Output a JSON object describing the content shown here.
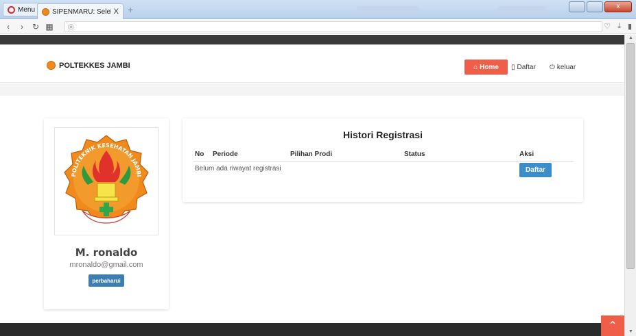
{
  "browser": {
    "menu_label": "Menu",
    "tab_title": "SIPENMARU: Seleksi Pener",
    "tab_close": "X",
    "new_tab": "+",
    "window_close": "x"
  },
  "navbar": {
    "brand": "POLTEKKES JAMBI",
    "home_label": "Home",
    "daftar_label": "Daftar",
    "keluar_label": "keluar"
  },
  "profile": {
    "name": "M. ronaldo",
    "email": "mronaldo@gmail.com",
    "update_button": "perbaharui",
    "logo_text": "POLITEKNIK KESEHATAN JAMBI"
  },
  "history": {
    "title": "Histori Registrasi",
    "columns": [
      "No",
      "Periode",
      "Pilihan Prodi",
      "Status",
      "Aksi"
    ],
    "empty_message": "Belum ada riwayat registrasi",
    "action_button": "Daftar"
  },
  "colors": {
    "accent": "#ef5e48",
    "primary_button": "#3b8ec9",
    "dark_bar": "#2b2b2b",
    "logo_orange": "#f08a1c"
  },
  "icons": {
    "home": "home-icon",
    "daftar": "book-icon",
    "keluar": "power-icon",
    "scroll_top": "chevron-up-icon"
  }
}
